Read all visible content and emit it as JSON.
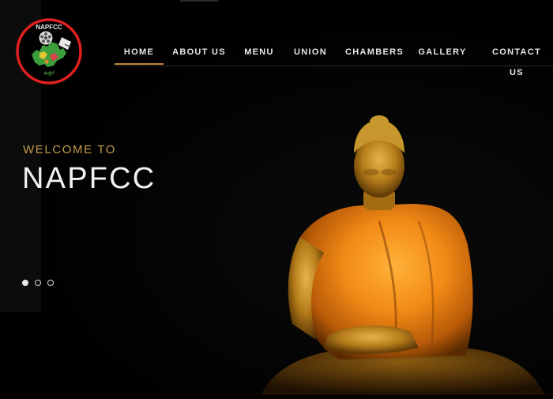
{
  "logo": {
    "text": "NAPFCC",
    "subtext": "ఉత్తర"
  },
  "nav": {
    "items": [
      {
        "label": "HOME",
        "active": true
      },
      {
        "label": "ABOUT US",
        "active": false
      },
      {
        "label": "MENU",
        "active": false
      },
      {
        "label": "UNION",
        "active": false
      },
      {
        "label": "CHAMBERS",
        "active": false
      },
      {
        "label": "GALLERY",
        "active": false
      },
      {
        "label": "CONTACT US",
        "active": false
      }
    ]
  },
  "hero": {
    "welcome": "WELCOME TO",
    "title": "NAPFCC",
    "slides": {
      "count": 3,
      "active_index": 0
    },
    "image": "buddha-statue"
  },
  "colors": {
    "accent": "#c08a2e",
    "welcome_text": "#c39a48",
    "background": "#000000",
    "logo_ring": "#e02020"
  }
}
